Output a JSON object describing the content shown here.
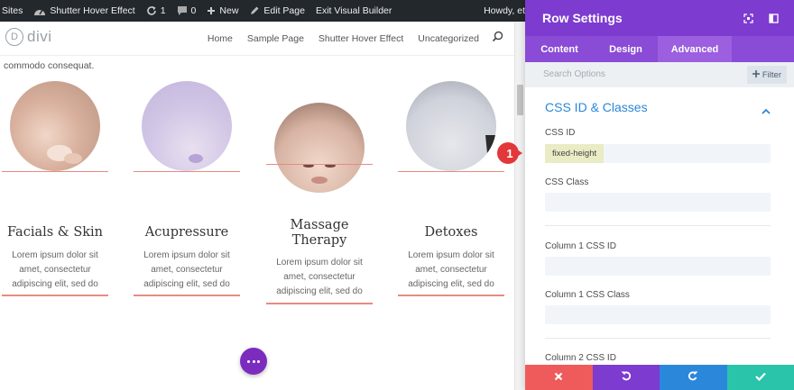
{
  "admin_bar": {
    "sites": "Sites",
    "site_name": "Shutter Hover Effect",
    "updates": "1",
    "comments": "0",
    "new": "New",
    "edit_page": "Edit Page",
    "exit_builder": "Exit Visual Builder",
    "howdy": "Howdy, et"
  },
  "site": {
    "logo_letter": "D",
    "logo_text": "divi",
    "nav": [
      "Home",
      "Sample Page",
      "Shutter Hover Effect",
      "Uncategorized"
    ],
    "intro_text": "commodo consequat."
  },
  "cards": [
    {
      "title": "Facials & Skin",
      "body": [
        "Lorem ipsum dolor sit",
        "amet, consectetur",
        "adipiscing elit, sed do"
      ]
    },
    {
      "title": "Acupressure",
      "body": [
        "Lorem ipsum dolor sit",
        "amet, consectetur",
        "adipiscing elit, sed do"
      ]
    },
    {
      "title": "Massage Therapy",
      "title_lines": [
        "Massage",
        "Therapy"
      ],
      "body": [
        "Lorem ipsum dolor sit",
        "amet, consectetur",
        "adipiscing elit, sed do"
      ]
    },
    {
      "title": "Detoxes",
      "body": [
        "Lorem ipsum dolor sit",
        "amet, consectetur",
        "adipiscing elit, sed do"
      ]
    }
  ],
  "panel": {
    "title": "Row Settings",
    "tabs": [
      "Content",
      "Design",
      "Advanced"
    ],
    "active_tab": "Advanced",
    "search_placeholder": "Search Options",
    "filter_label": "Filter",
    "section_title": "CSS ID & Classes",
    "fields": [
      {
        "label": "CSS ID",
        "value": "fixed-height"
      },
      {
        "label": "CSS Class",
        "value": ""
      },
      {
        "label": "Column 1 CSS ID",
        "value": ""
      },
      {
        "label": "Column 1 CSS Class",
        "value": ""
      },
      {
        "label": "Column 2 CSS ID",
        "value": ""
      }
    ]
  },
  "callout": {
    "number": "1"
  },
  "colors": {
    "admin_bar": "#23282d",
    "panel_header": "#7d3bd0",
    "tabs": "#8a4bd6",
    "active_tab": "#9b5fe0",
    "accent_line": "#e88b82",
    "section_title": "#2b87da",
    "cancel": "#ef5b5b",
    "undo": "#7d3bd0",
    "redo": "#2b87da",
    "save": "#29c4a9",
    "callout": "#e2383a"
  }
}
